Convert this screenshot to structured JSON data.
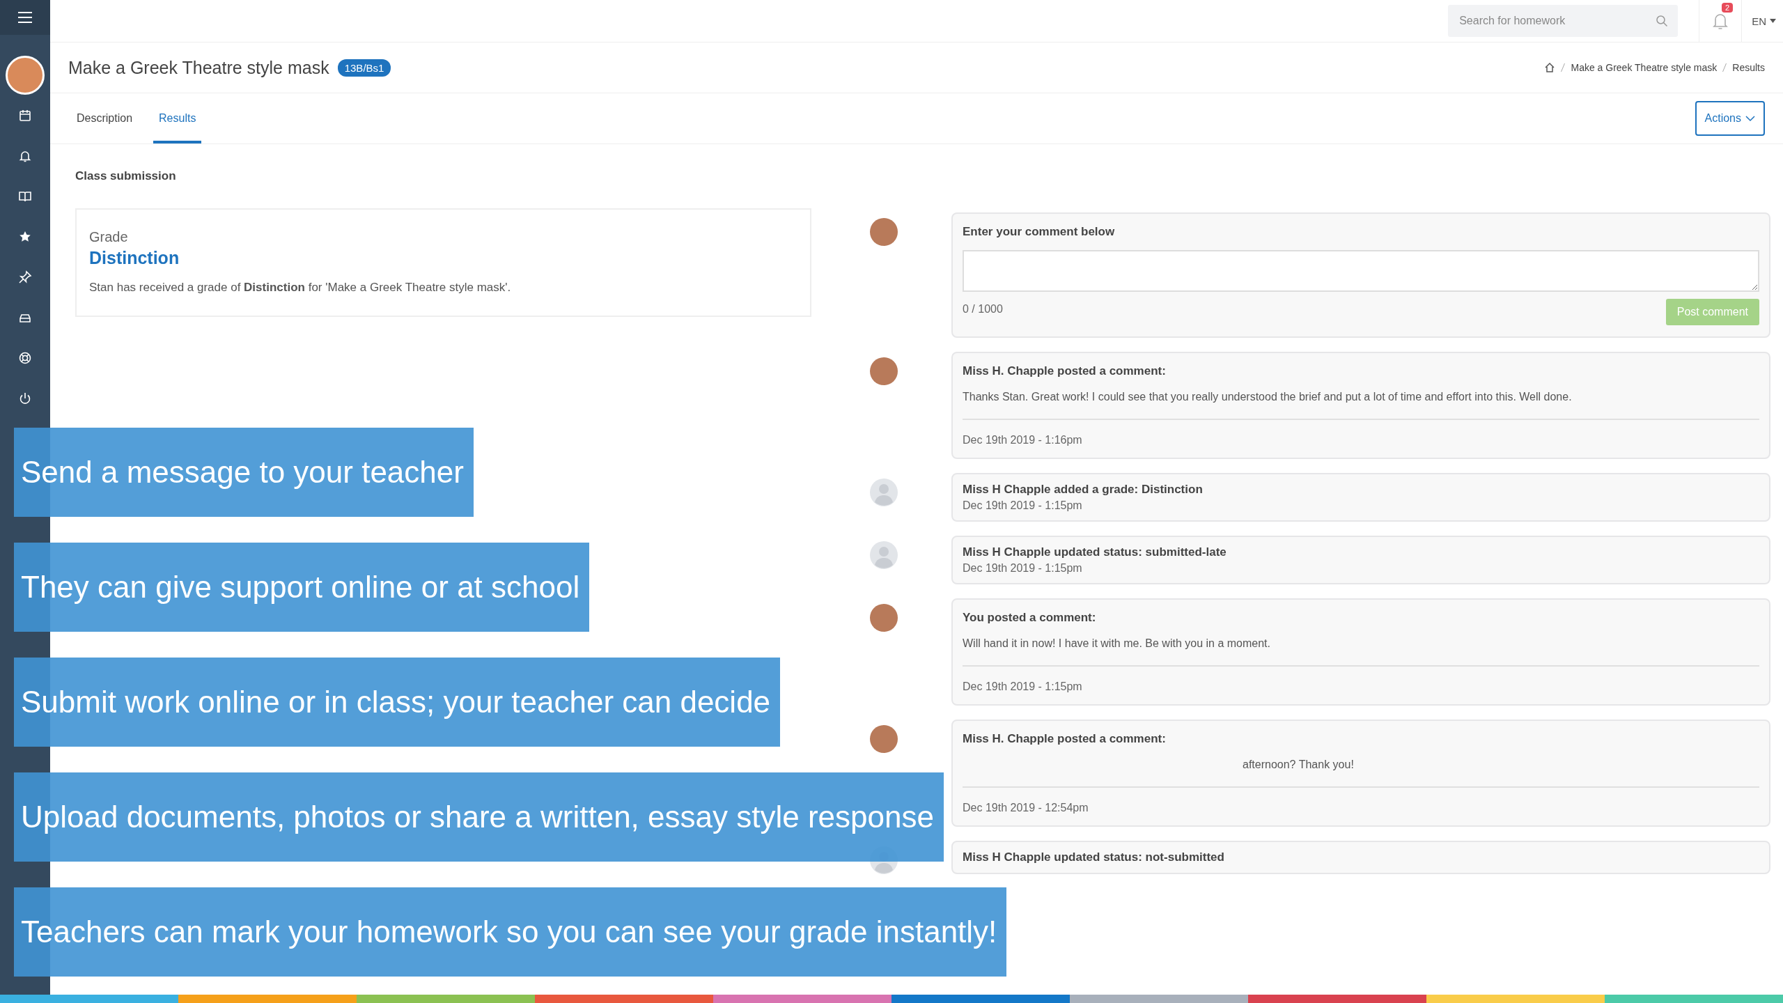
{
  "topbar": {
    "search": {
      "placeholder": "Search for homework"
    },
    "notifications": {
      "count": "2"
    },
    "language": "EN"
  },
  "header": {
    "title": "Make a Greek Theatre style mask",
    "badge": "13B/Bs1",
    "breadcrumb": [
      "Make a Greek Theatre style mask",
      "Results"
    ]
  },
  "tabs": [
    {
      "label": "Description",
      "selected": false
    },
    {
      "label": "Results",
      "selected": true
    }
  ],
  "actions_button": "Actions",
  "section_title": "Class submission",
  "grade_card": {
    "label": "Grade",
    "value": "Distinction",
    "text": "Stan has received a grade of **Distinction** for 'Make a Greek Theatre style mask'."
  },
  "comment_form": {
    "label": "Enter your comment below",
    "counter": "0 / 1000",
    "button": "Post comment"
  },
  "timeline": [
    {
      "kind": "comment",
      "avatar_photo": true,
      "title": "Miss H. Chapple posted a comment:",
      "body": "Thanks Stan. Great work! I could see that you really understood the brief and put a lot of time and effort into this. Well done.",
      "date": "Dec 19th 2019 - 1:16pm"
    },
    {
      "kind": "event",
      "avatar_photo": false,
      "title": "Miss H Chapple added a grade: Distinction",
      "date": "Dec 19th 2019 - 1:15pm"
    },
    {
      "kind": "event",
      "avatar_photo": false,
      "title": "Miss H Chapple updated status: submitted-late",
      "date": "Dec 19th 2019 - 1:15pm"
    },
    {
      "kind": "comment",
      "avatar_photo": true,
      "title": "You posted a comment:",
      "body": "Will hand it in now! I have it with me. Be with you in a moment.",
      "date": "Dec 19th 2019 - 1:15pm"
    },
    {
      "kind": "comment",
      "avatar_photo": true,
      "title": "Miss H. Chapple posted a comment:",
      "body": "afternoon? Thank you!",
      "date": "Dec 19th 2019 - 12:54pm"
    },
    {
      "kind": "event",
      "avatar_photo": false,
      "title": "Miss H Chapple updated status: not-submitted"
    }
  ],
  "banners": [
    "Send a message to your teacher",
    "They can give support online or at school",
    "Submit work online or in class; your teacher can decide",
    "Upload documents, photos or share a written, essay style response",
    "Teachers can mark your homework so you can see your grade instantly!"
  ]
}
